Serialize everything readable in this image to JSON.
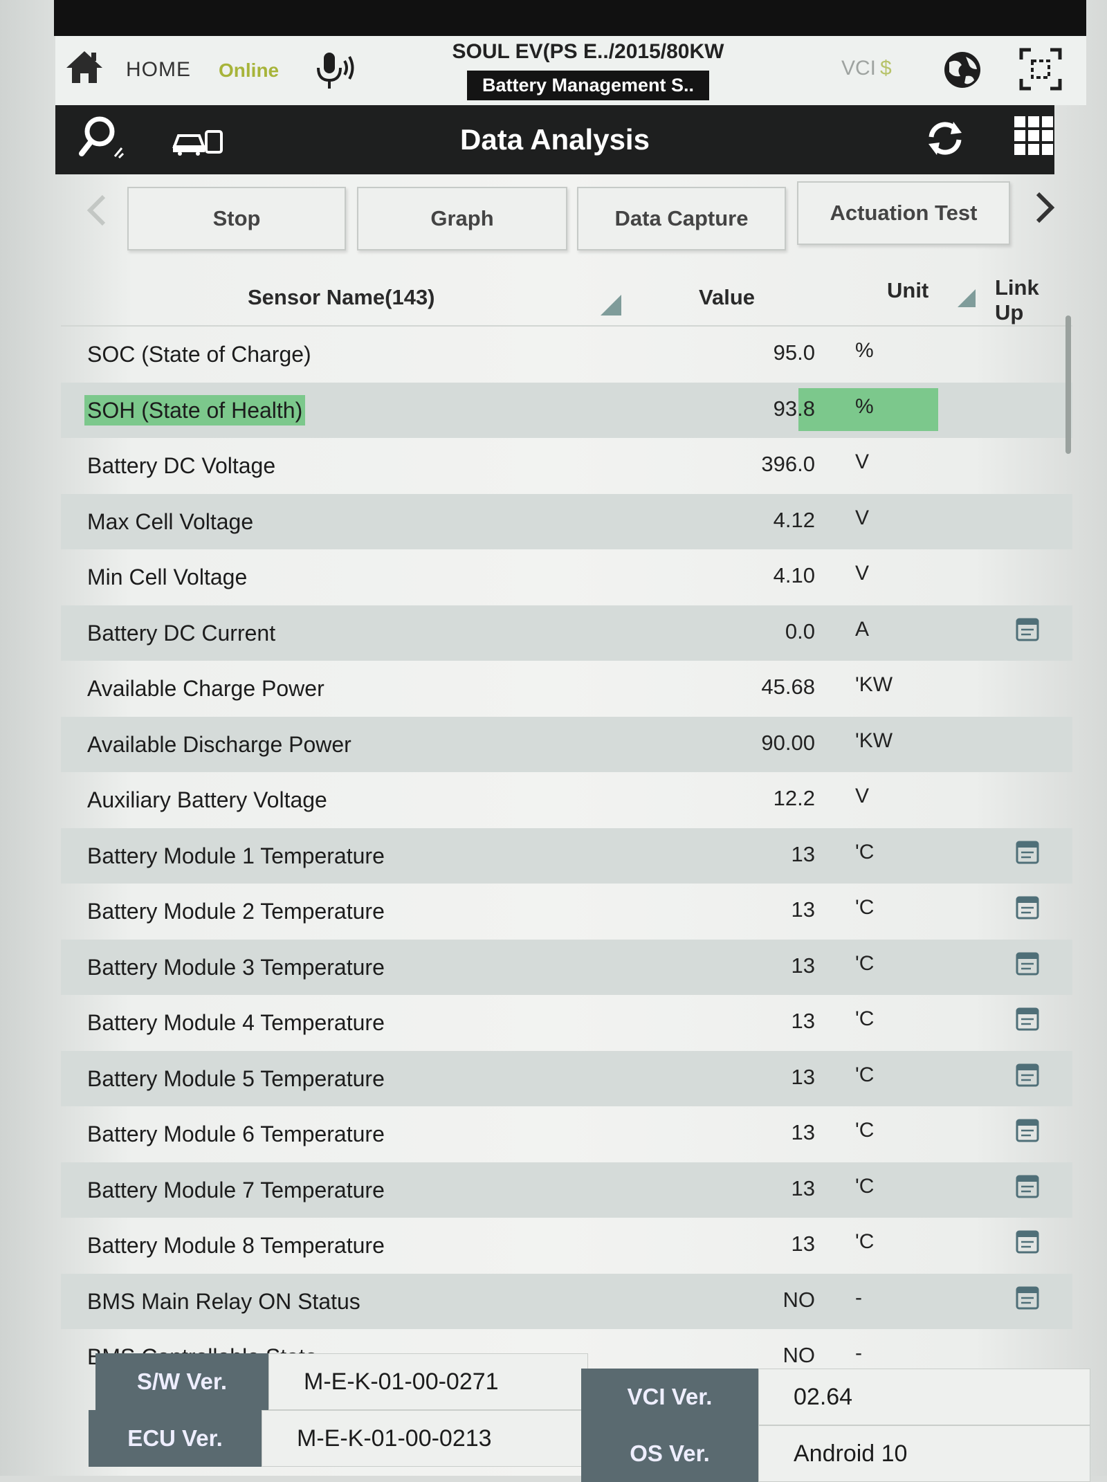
{
  "header": {
    "home_label": "HOME",
    "online_label": "Online",
    "vehicle_title": "SOUL EV(PS E../2015/80KW",
    "module_title": "Battery Management S..",
    "vci_label": "VCI",
    "vci_symbol": "$",
    "icons": [
      "home-icon",
      "microphone-icon",
      "globe-icon",
      "screen-capture-icon"
    ]
  },
  "titlebar": {
    "title": "Data Analysis",
    "icons": [
      "search-icon",
      "vehicle-icon",
      "refresh-icon",
      "grid-menu-icon"
    ]
  },
  "tabs": [
    {
      "label": "Stop"
    },
    {
      "label": "Graph"
    },
    {
      "label": "Data Capture"
    },
    {
      "label": "Actuation Test"
    }
  ],
  "table": {
    "headers": {
      "sensor": "Sensor Name(143)",
      "value": "Value",
      "unit": "Unit",
      "link": "Link Up"
    },
    "rows": [
      {
        "name": "SOC (State of Charge)",
        "value": "95.0",
        "unit": "%",
        "link": false
      },
      {
        "name": "SOH (State of Health)",
        "value": "93.8",
        "unit": "%",
        "link": false,
        "highlight": true
      },
      {
        "name": "Battery DC Voltage",
        "value": "396.0",
        "unit": "V",
        "link": false
      },
      {
        "name": "Max Cell Voltage",
        "value": "4.12",
        "unit": "V",
        "link": false
      },
      {
        "name": "Min Cell Voltage",
        "value": "4.10",
        "unit": "V",
        "link": false
      },
      {
        "name": "Battery DC Current",
        "value": "0.0",
        "unit": "A",
        "link": true
      },
      {
        "name": "Available Charge Power",
        "value": "45.68",
        "unit": "'KW",
        "link": false
      },
      {
        "name": "Available Discharge Power",
        "value": "90.00",
        "unit": "'KW",
        "link": false
      },
      {
        "name": "Auxiliary Battery Voltage",
        "value": "12.2",
        "unit": "V",
        "link": false
      },
      {
        "name": "Battery Module 1 Temperature",
        "value": "13",
        "unit": "'C",
        "link": true
      },
      {
        "name": "Battery Module 2 Temperature",
        "value": "13",
        "unit": "'C",
        "link": true
      },
      {
        "name": "Battery Module 3 Temperature",
        "value": "13",
        "unit": "'C",
        "link": true
      },
      {
        "name": "Battery Module 4 Temperature",
        "value": "13",
        "unit": "'C",
        "link": true
      },
      {
        "name": "Battery Module 5 Temperature",
        "value": "13",
        "unit": "'C",
        "link": true
      },
      {
        "name": "Battery Module 6 Temperature",
        "value": "13",
        "unit": "'C",
        "link": true
      },
      {
        "name": "Battery Module 7 Temperature",
        "value": "13",
        "unit": "'C",
        "link": true
      },
      {
        "name": "Battery Module 8 Temperature",
        "value": "13",
        "unit": "'C",
        "link": true
      },
      {
        "name": "BMS Main Relay ON Status",
        "value": "NO",
        "unit": "-",
        "link": true
      },
      {
        "name": "BMS Controllable State",
        "value": "NO",
        "unit": "-",
        "link": false
      }
    ]
  },
  "footer": {
    "sw_label": "S/W Ver.",
    "sw_value": "M-E-K-01-00-0271",
    "ecu_label": "ECU Ver.",
    "ecu_value": "M-E-K-01-00-0213",
    "vci_label": "VCI Ver.",
    "vci_value": "02.64",
    "os_label": "OS Ver.",
    "os_value": "Android 10"
  },
  "colors": {
    "highlight": "#7cc88c",
    "titlebar": "#1e1f1f",
    "online": "#a7b43a",
    "row_shade": "#d5dbd9",
    "footer_label": "#5a6a70"
  }
}
